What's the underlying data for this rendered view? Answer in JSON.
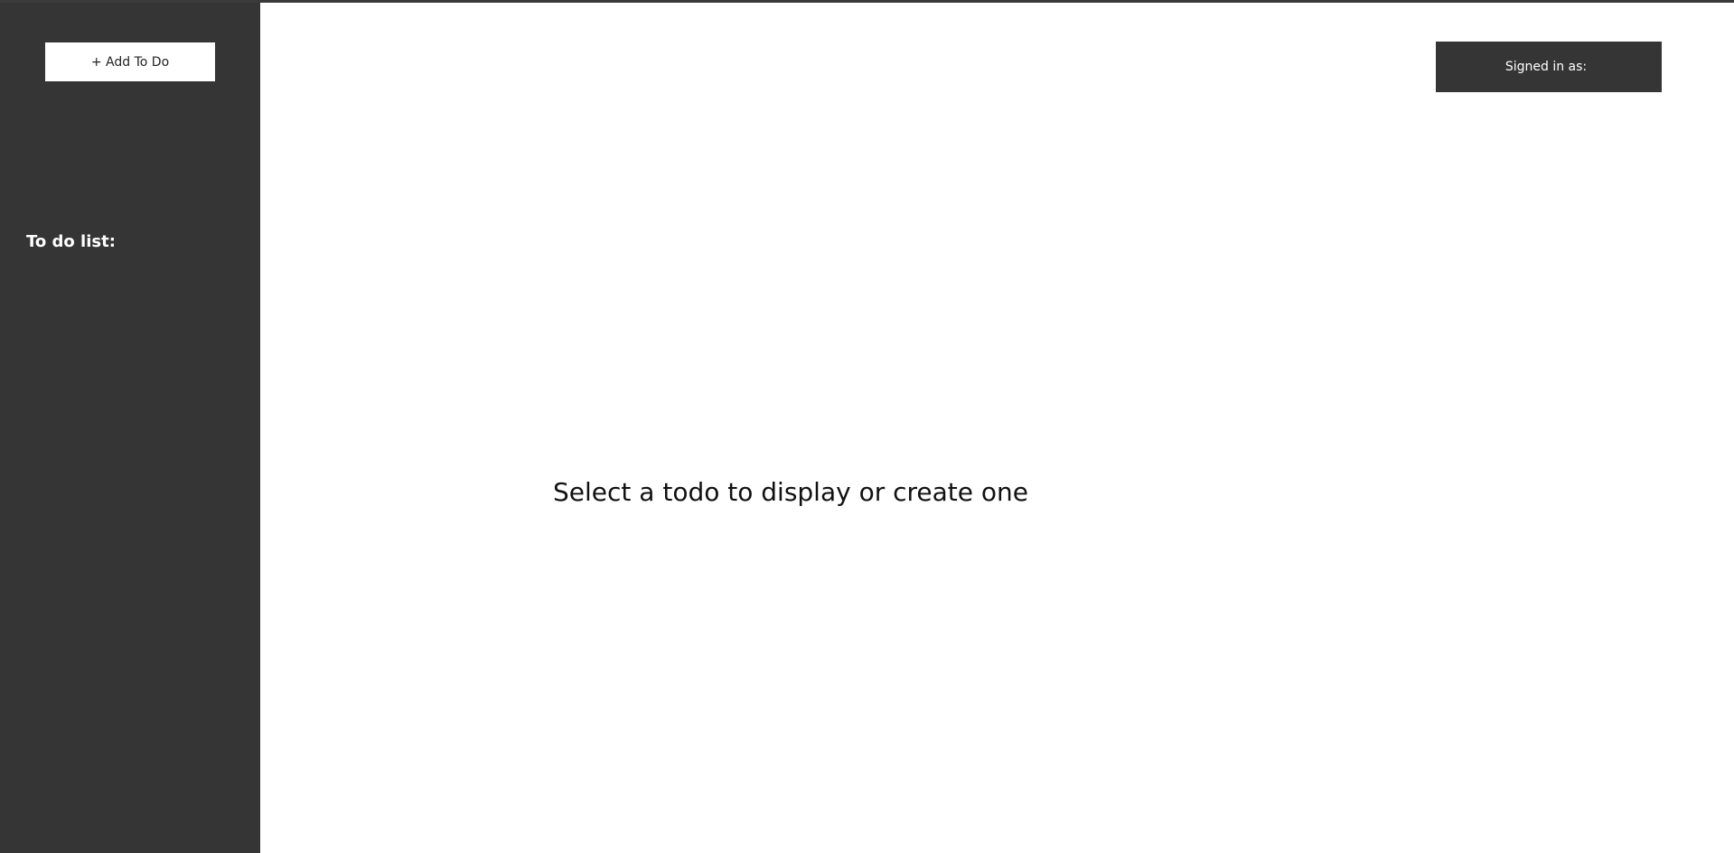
{
  "sidebar": {
    "add_button_label": "+ Add To Do",
    "list_title": "To do list:",
    "items": []
  },
  "header": {
    "signed_in_label": "Signed in as:",
    "username": ""
  },
  "main": {
    "empty_message": "Select a todo to display or create one"
  },
  "colors": {
    "sidebar_background": "#353535",
    "main_background": "#ffffff",
    "button_background": "#ffffff",
    "signed_in_background": "#353535"
  }
}
